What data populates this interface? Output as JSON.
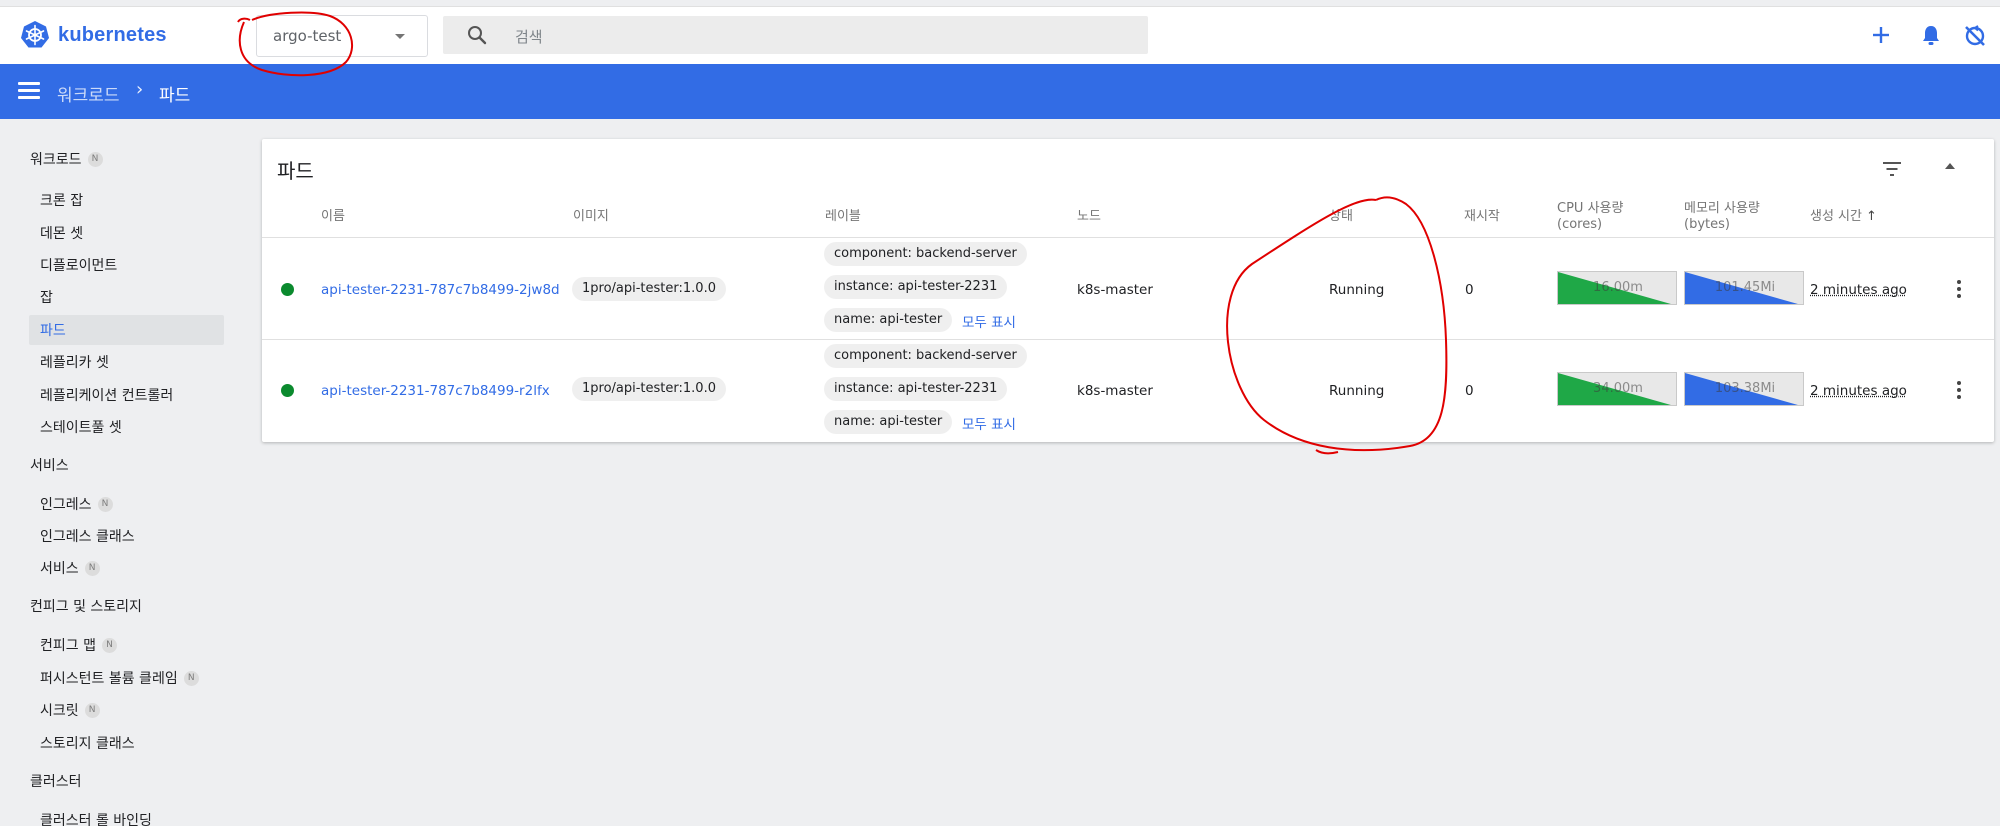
{
  "app": {
    "title": "kubernetes",
    "namespace": "argo-test",
    "search_placeholder": "검색",
    "accent": "#326ce5"
  },
  "icons": {
    "logo": "kubernetes-helm-icon",
    "search": "search-icon",
    "add": "plus-icon",
    "notifications": "bell-icon",
    "sync": "sync-disabled-icon",
    "menu": "hamburger-icon",
    "filter": "filter-icon",
    "collapse": "chevron-up-icon",
    "row_menu": "more-vert-icon"
  },
  "breadcrumb": {
    "parent": "워크로드",
    "separator": "›",
    "current": "파드"
  },
  "sidebar": {
    "sections": [
      {
        "label": "워크로드",
        "badge": "N"
      },
      {
        "label": "서비스"
      },
      {
        "label": "컨피그 및 스토리지"
      },
      {
        "label": "클러스터"
      }
    ],
    "items": [
      {
        "label": "크론 잡"
      },
      {
        "label": "데몬 셋"
      },
      {
        "label": "디플로이먼트"
      },
      {
        "label": "잡"
      },
      {
        "label": "파드"
      },
      {
        "label": "레플리카 셋"
      },
      {
        "label": "레플리케이션 컨트롤러"
      },
      {
        "label": "스테이트풀 셋"
      },
      {
        "label": "인그레스",
        "badge": "N"
      },
      {
        "label": "인그레스 클래스"
      },
      {
        "label": "서비스",
        "badge": "N"
      },
      {
        "label": "컨피그 맵",
        "badge": "N"
      },
      {
        "label": "퍼시스턴트 볼륨 클레임",
        "badge": "N"
      },
      {
        "label": "시크릿",
        "badge": "N"
      },
      {
        "label": "스토리지 클래스"
      },
      {
        "label": "클러스터 롤 바인딩"
      }
    ]
  },
  "pods": {
    "title": "파드",
    "columns": {
      "name": "이름",
      "image": "이미지",
      "labels": "레이블",
      "node": "노드",
      "status": "상태",
      "restarts": "재시작",
      "cpu": "CPU 사용량",
      "cpu_unit": "(cores)",
      "memory": "메모리 사용량",
      "memory_unit": "(bytes)",
      "created": "생성 시간",
      "sort_indicator": "↑"
    },
    "rows": [
      {
        "name": "api-tester-2231-787c7b8499-2jw8d",
        "image": "1pro/api-tester:1.0.0",
        "labels": [
          "component: backend-server",
          "instance: api-tester-2231",
          "name: api-tester"
        ],
        "show_all": "모두 표시",
        "node": "k8s-master",
        "status": "Running",
        "restarts": "0",
        "cpu": "16.00m",
        "memory": "101.45Mi",
        "created": "2 minutes ago"
      },
      {
        "name": "api-tester-2231-787c7b8499-r2lfx",
        "image": "1pro/api-tester:1.0.0",
        "labels": [
          "component: backend-server",
          "instance: api-tester-2231",
          "name: api-tester"
        ],
        "show_all": "모두 표시",
        "node": "k8s-master",
        "status": "Running",
        "restarts": "0",
        "cpu": "34.00m",
        "memory": "103.38Mi",
        "created": "2 minutes ago"
      }
    ]
  },
  "colors": {
    "running": "#0b8a2e",
    "cpu_fill": "#1fa847",
    "memory_fill": "#326ce5",
    "annotation": "#e00000"
  }
}
